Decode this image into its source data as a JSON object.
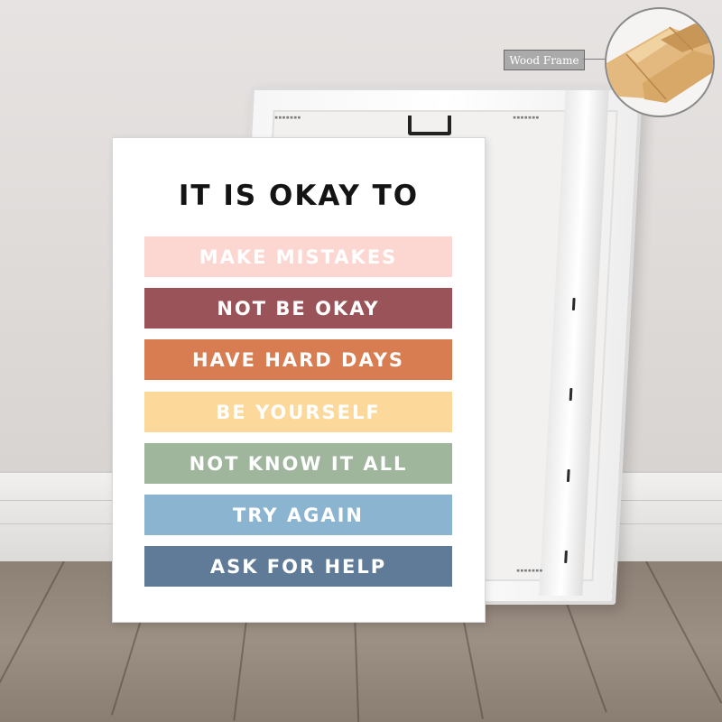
{
  "poster": {
    "title": "IT IS OKAY TO",
    "items": [
      {
        "label": "MAKE MISTAKES",
        "color": "#fcd7d2"
      },
      {
        "label": "NOT BE OKAY",
        "color": "#9a5459"
      },
      {
        "label": "HAVE HARD DAYS",
        "color": "#d87d51"
      },
      {
        "label": "BE YOURSELF",
        "color": "#fcd89a"
      },
      {
        "label": "NOT KNOW IT ALL",
        "color": "#9fb59c"
      },
      {
        "label": "TRY AGAIN",
        "color": "#8bb4d1"
      },
      {
        "label": "ASK FOR HELP",
        "color": "#5f7b98"
      }
    ]
  },
  "callout": {
    "label": "Wood Frame",
    "icon": "wood-frame-detail-icon"
  },
  "colors": {
    "wall": "#e2dfdd",
    "floor": "#958879",
    "baseboard": "#ecebea",
    "wood": "#e2b67a",
    "text_dark": "#141414"
  }
}
